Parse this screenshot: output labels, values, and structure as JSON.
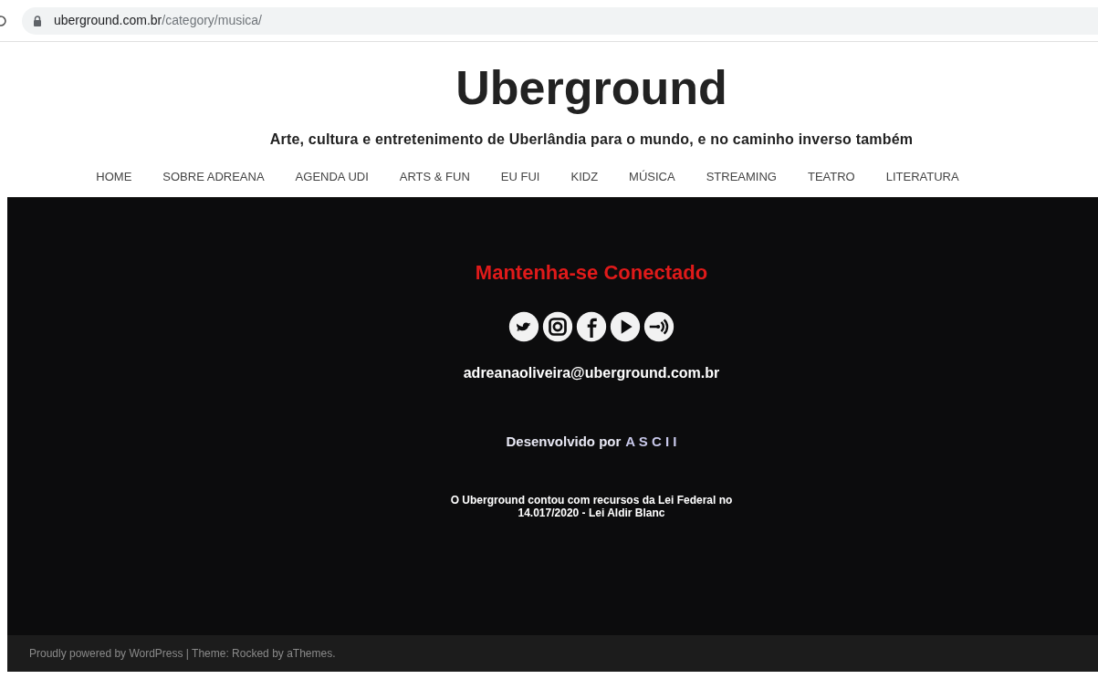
{
  "browser": {
    "url_host": "uberground.com.br",
    "url_path": "/category/musica/"
  },
  "site": {
    "title": "Uberground",
    "tagline": "Arte, cultura e entretenimento de Uberlândia para o mundo, e no caminho inverso também"
  },
  "nav": [
    {
      "label": "HOME"
    },
    {
      "label": "SOBRE ADREANA"
    },
    {
      "label": "AGENDA UDI"
    },
    {
      "label": "ARTS & FUN"
    },
    {
      "label": "EU FUI"
    },
    {
      "label": "KIDZ"
    },
    {
      "label": "MÚSICA"
    },
    {
      "label": "STREAMING"
    },
    {
      "label": "TEATRO"
    },
    {
      "label": "LITERATURA"
    }
  ],
  "footer_widget": {
    "heading": "Mantenha-se Conectado",
    "social": [
      {
        "kind": "twitter"
      },
      {
        "kind": "instagram"
      },
      {
        "kind": "facebook"
      },
      {
        "kind": "play"
      },
      {
        "kind": "podcast"
      }
    ],
    "email": "adreanaoliveira@uberground.com.br",
    "developed_by": "Desenvolvido por",
    "developer": "A S C I I",
    "notice_lines": [
      "O Uberground contou com recursos da Lei Federal no",
      "14.017/2020 - Lei Aldir Blanc"
    ]
  },
  "credits": "Proudly powered by WordPress | Theme: Rocked by aThemes."
}
